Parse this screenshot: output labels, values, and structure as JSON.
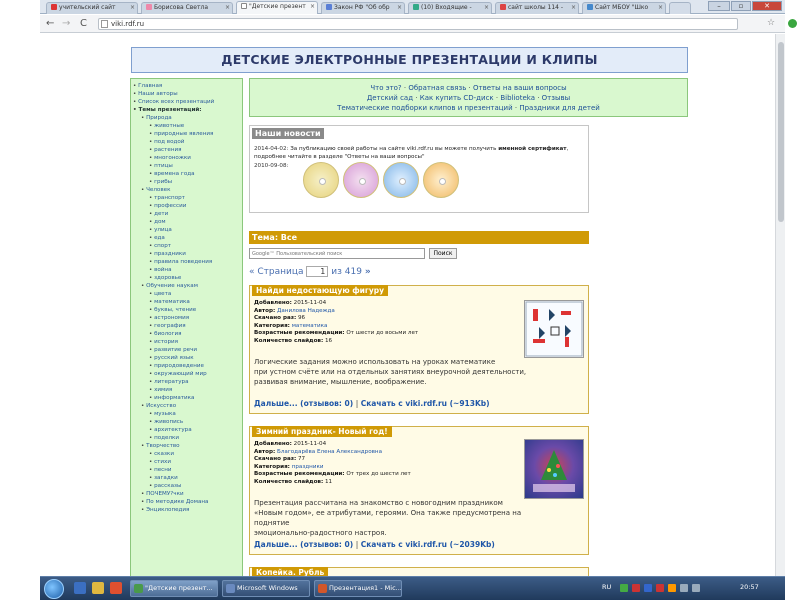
{
  "browser": {
    "tabs": [
      {
        "label": "учительский сайт",
        "active": false,
        "color": "#d33"
      },
      {
        "label": "Борисова Светла",
        "active": false,
        "color": "#e8a"
      },
      {
        "label": "\"Детские презент",
        "active": true,
        "color": "#888"
      },
      {
        "label": "Закон РФ \"Об обр",
        "active": false,
        "color": "#5a7fd6"
      },
      {
        "label": "(10) Входящие - ",
        "active": false,
        "color": "#3a8"
      },
      {
        "label": "сайт школы 114 - ",
        "active": false,
        "color": "#d44"
      },
      {
        "label": "Сайт МБОУ \"Шко",
        "active": false,
        "color": "#48c"
      }
    ],
    "url": "viki.rdf.ru"
  },
  "header": {
    "title": "ДЕТСКИЕ ЭЛЕКТРОННЫЕ ПРЕЗЕНТАЦИИ И КЛИПЫ"
  },
  "sidebar": {
    "items": [
      {
        "label": "Главная",
        "level": 1
      },
      {
        "label": "Наши авторы",
        "level": 1
      },
      {
        "label": "Список всех презентаций",
        "level": 1
      },
      {
        "label": "Темы презентаций:",
        "level": 1,
        "bold": true
      },
      {
        "label": "Природа",
        "level": 2
      },
      {
        "label": "животные",
        "level": 3
      },
      {
        "label": "природные явления",
        "level": 3
      },
      {
        "label": "под водой",
        "level": 3
      },
      {
        "label": "растения",
        "level": 3
      },
      {
        "label": "многоножки",
        "level": 3
      },
      {
        "label": "птицы",
        "level": 3
      },
      {
        "label": "времена года",
        "level": 3
      },
      {
        "label": "грибы",
        "level": 3
      },
      {
        "label": "Человек",
        "level": 2
      },
      {
        "label": "транспорт",
        "level": 3
      },
      {
        "label": "профессии",
        "level": 3
      },
      {
        "label": "дети",
        "level": 3
      },
      {
        "label": "дом",
        "level": 3
      },
      {
        "label": "улица",
        "level": 3
      },
      {
        "label": "еда",
        "level": 3
      },
      {
        "label": "спорт",
        "level": 3
      },
      {
        "label": "праздники",
        "level": 3
      },
      {
        "label": "правила поведения",
        "level": 3
      },
      {
        "label": "война",
        "level": 3
      },
      {
        "label": "здоровье",
        "level": 3
      },
      {
        "label": "Обучение наукам",
        "level": 2
      },
      {
        "label": "цвета",
        "level": 3
      },
      {
        "label": "математика",
        "level": 3
      },
      {
        "label": "буквы, чтение",
        "level": 3
      },
      {
        "label": "астрономия",
        "level": 3
      },
      {
        "label": "география",
        "level": 3
      },
      {
        "label": "биология",
        "level": 3
      },
      {
        "label": "история",
        "level": 3
      },
      {
        "label": "развитие речи",
        "level": 3
      },
      {
        "label": "русский язык",
        "level": 3
      },
      {
        "label": "природоведение",
        "level": 3
      },
      {
        "label": "окружающий мир",
        "level": 3
      },
      {
        "label": "литература",
        "level": 3
      },
      {
        "label": "химия",
        "level": 3
      },
      {
        "label": "информатика",
        "level": 3
      },
      {
        "label": "Искусство",
        "level": 2
      },
      {
        "label": "музыка",
        "level": 3
      },
      {
        "label": "живопись",
        "level": 3
      },
      {
        "label": "архитектура",
        "level": 3
      },
      {
        "label": "поделки",
        "level": 3
      },
      {
        "label": "Творчество",
        "level": 2
      },
      {
        "label": "сказки",
        "level": 3
      },
      {
        "label": "стихи",
        "level": 3
      },
      {
        "label": "песни",
        "level": 3
      },
      {
        "label": "загадки",
        "level": 3
      },
      {
        "label": "рассказы",
        "level": 3
      },
      {
        "label": "ПОЧЕМУ?чки",
        "level": 2
      },
      {
        "label": "По методике Домана",
        "level": 2
      },
      {
        "label": "Энциклопедия",
        "level": 2
      }
    ]
  },
  "topnav": {
    "line1": [
      "Что это?",
      "Обратная связь",
      "Ответы на ваши вопросы"
    ],
    "line2": [
      "Детский сад",
      "Как купить CD-диск",
      "Biblioteka",
      "Отзывы"
    ],
    "line3": [
      "Тематические подборки клипов и презентаций",
      "Праздники для детей"
    ]
  },
  "news": {
    "title": "Наши новости",
    "entry1_date": "2014-04-02:",
    "entry1_text": "За публикацию своей работы на сайте viki.rdf.ru вы можете получить",
    "entry1_bold1": "именной сертификат",
    "entry1_text2": ", подробнее читайте в разделе \"Ответы на ваши вопросы\"",
    "entry2_date": "2010-09-08:"
  },
  "theme": {
    "label": "Тема: Все"
  },
  "search": {
    "placeholder": "Google™ Пользовательский поиск",
    "button": "Поиск"
  },
  "pager": {
    "prev": "« Страница",
    "current": "1",
    "of": "из 419",
    "next": "»"
  },
  "labels": {
    "added": "Добавлено:",
    "author": "Автор:",
    "downloaded": "Скачано раз:",
    "category": "Категория:",
    "age": "Возрастные рекомендации:",
    "slides": "Количество слайдов:"
  },
  "items": [
    {
      "title": "Найди недостающую фигуру",
      "added": "2015-11-04",
      "author": "Данилова Надежда",
      "downloaded": "96",
      "category": "математика",
      "age": "От шести до восьми лет",
      "slides": "16",
      "desc1": "Логические задания можно использовать на уроках математике",
      "desc2": "при устном счёте или на отдельных занятиях внеурочной деятельности,",
      "desc3": "развивая внимание, мышление, воображение.",
      "more": "Дальше... (отзывов: 0)",
      "download": "Скачать с viki.rdf.ru (~913Kb)"
    },
    {
      "title": "Зимний праздник- Новый год!",
      "added": "2015-11-04",
      "author": "Благодарёва Елена Александровна",
      "downloaded": "77",
      "category": "праздники",
      "age": "От трех до шести лет",
      "slides": "11",
      "desc1": "Презентация рассчитана на знакомство с новогодним праздником",
      "desc2": "«Новым годом», ее атрибутами, героями. Она также предусмотрена на поднятие",
      "desc3": "эмоционально-радостного настроя.",
      "more": "Дальше... (отзывов: 0)",
      "download": "Скачать с viki.rdf.ru (~2039Kb)"
    },
    {
      "title": "Копейка. Рубль"
    }
  ],
  "taskbar": {
    "tasks": [
      "\"Детские презент...",
      "Microsoft Windows",
      "Презентация1 - Mic..."
    ],
    "lang": "RU",
    "time": "20:57"
  }
}
